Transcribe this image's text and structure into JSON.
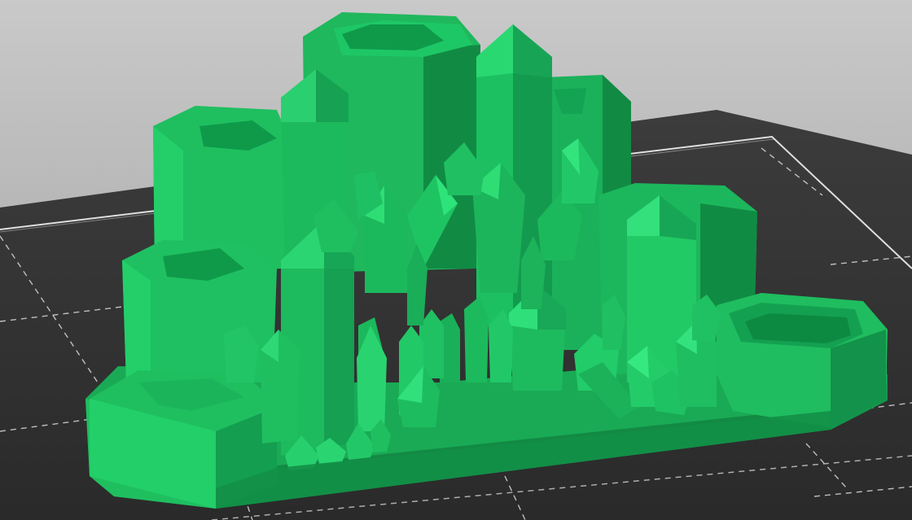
{
  "app": {
    "view": "3d-slicer-viewport"
  },
  "colors": {
    "background_top": "#c9c9c9",
    "background_bottom": "#8a8a8a",
    "bed_dark": "#2f2f2f",
    "bed_lines": "#f2f2f2",
    "model_base": "#1fb35a",
    "model_light": "#22d46a",
    "model_dark": "#0f8a44",
    "model_highlight": "#34e57d"
  },
  "icons": {
    "bed": "build-plate-icon",
    "model": "crystal-model-icon"
  }
}
